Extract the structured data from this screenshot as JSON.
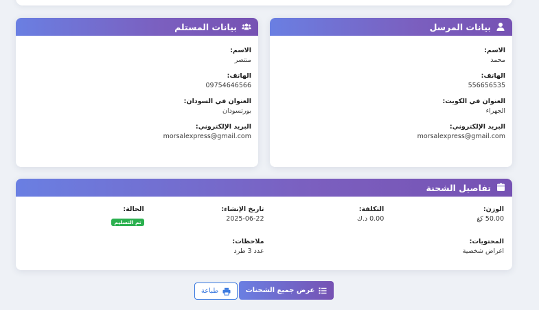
{
  "sender": {
    "title": "بيانات المرسل",
    "name_label": "الاسم:",
    "name": "محمد",
    "phone_label": "الهاتف:",
    "phone": "556656535",
    "address_label": "العنوان في الكويت:",
    "address": "الجهراء",
    "email_label": "البريد الإلكتروني:",
    "email": "morsalexpress@gmail.com"
  },
  "receiver": {
    "title": "بيانات المستلم",
    "name_label": "الاسم:",
    "name": "منتصر",
    "phone_label": "الهاتف:",
    "phone": "09754646566",
    "address_label": "العنوان في السودان:",
    "address": "بورتسودان",
    "email_label": "البريد الإلكتروني:",
    "email": "morsalexpress@gmail.com"
  },
  "shipment": {
    "title": "تفاصيل الشحنة",
    "weight_label": "الوزن:",
    "weight": "50.00 كغ",
    "cost_label": "التكلفة:",
    "cost": "0.00 د.ك",
    "created_label": "تاريخ الإنشاء:",
    "created": "2025-06-22",
    "status_label": "الحالة:",
    "status": "تم التسليم",
    "contents_label": "المحتويات:",
    "contents": "اغراض شخصية",
    "notes_label": "ملاحظات:",
    "notes": "عدد 3 طرد"
  },
  "actions": {
    "view_all": "عرض جميع الشحنات",
    "print": "طباعة"
  },
  "colors": {
    "header_start": "#6a7fe2",
    "header_end": "#7652b3",
    "status_green": "#2bb04f",
    "print_blue": "#3d7be0"
  }
}
